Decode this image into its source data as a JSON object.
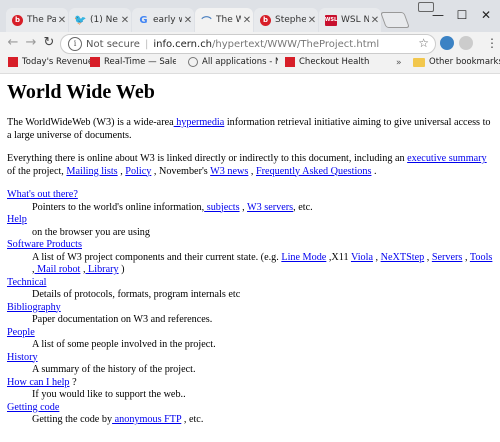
{
  "tabs": [
    {
      "title": "The Pa",
      "icon": "b",
      "color": "#d71e28"
    },
    {
      "title": "(1) Ne",
      "icon": "twitter",
      "color": "#1da1f2"
    },
    {
      "title": "early w",
      "icon": "G",
      "color": "#4285f4"
    },
    {
      "title": "The W",
      "icon": "globe",
      "color": "#4a7fbf",
      "active": true
    },
    {
      "title": "Stephe",
      "icon": "b",
      "color": "#d71e28"
    },
    {
      "title": "WSL N",
      "icon": "WSL",
      "color": "#c8102e"
    }
  ],
  "omnibox": {
    "security": "Not secure",
    "host": "info.cern.ch",
    "path": "/hypertext/WWW/TheProject.html"
  },
  "bookmarks": [
    {
      "label": "Today's Revenue",
      "color": "#d71e28"
    },
    {
      "label": "Real-Time — Sales b",
      "color": "#d71e28"
    },
    {
      "label": "All applications - Ne",
      "color": "#777"
    },
    {
      "label": "Checkout Health",
      "color": "#d71e28"
    }
  ],
  "other_bookmarks": "Other bookmarks",
  "page": {
    "title": "World Wide Web",
    "intro": {
      "before": "The WorldWideWeb (W3) is a wide-area",
      "link": " hypermedia",
      "after": " information retrieval initiative aiming to give universal access to a large universe of documents."
    },
    "everything": {
      "t1": "Everything there is online about W3 is linked directly or indirectly to this document, including an ",
      "l1": "executive summary",
      "t2": " of the project, ",
      "l2": "Mailing lists",
      "t3": " , ",
      "l3": "Policy",
      "t4": " , November's ",
      "l4": "W3 news",
      "t5": " , ",
      "l5": "Frequently Asked Questions",
      "t6": " ."
    },
    "whats_out": {
      "dt": "What's out there?",
      "t1": "Pointers to the world's online information,",
      "l1": " subjects",
      "t2": " , ",
      "l2": "W3 servers",
      "t3": ", etc."
    },
    "help": {
      "dt": "Help",
      "dd": "on the browser you are using"
    },
    "software": {
      "dt": "Software Products",
      "t1": "A list of W3 project components and their current state. (e.g. ",
      "l1": "Line Mode",
      "t2": " ,X11 ",
      "l2": "Viola",
      "t3": " , ",
      "l3": "NeXTStep",
      "t4": " , ",
      "l4": "Servers",
      "t5": " , ",
      "l5": "Tools",
      "t6": " ,",
      "l6": " Mail robot",
      "t7": " ,",
      "l7": " Library",
      "t8": " )"
    },
    "technical": {
      "dt": "Technical",
      "dd": "Details of protocols, formats, program internals etc"
    },
    "bibliography": {
      "dt": "Bibliography",
      "dd": "Paper documentation on W3 and references."
    },
    "people": {
      "dt": "People",
      "dd": "A list of some people involved in the project."
    },
    "history": {
      "dt": "History",
      "dd": "A summary of the history of the project."
    },
    "howcan": {
      "dt": "How can I help",
      "dt_after": " ?",
      "dd": "If you would like to support the web.."
    },
    "getting": {
      "dt": "Getting code",
      "t1": "Getting the code by",
      "l1": " anonymous FTP",
      "t2": " , etc."
    }
  }
}
